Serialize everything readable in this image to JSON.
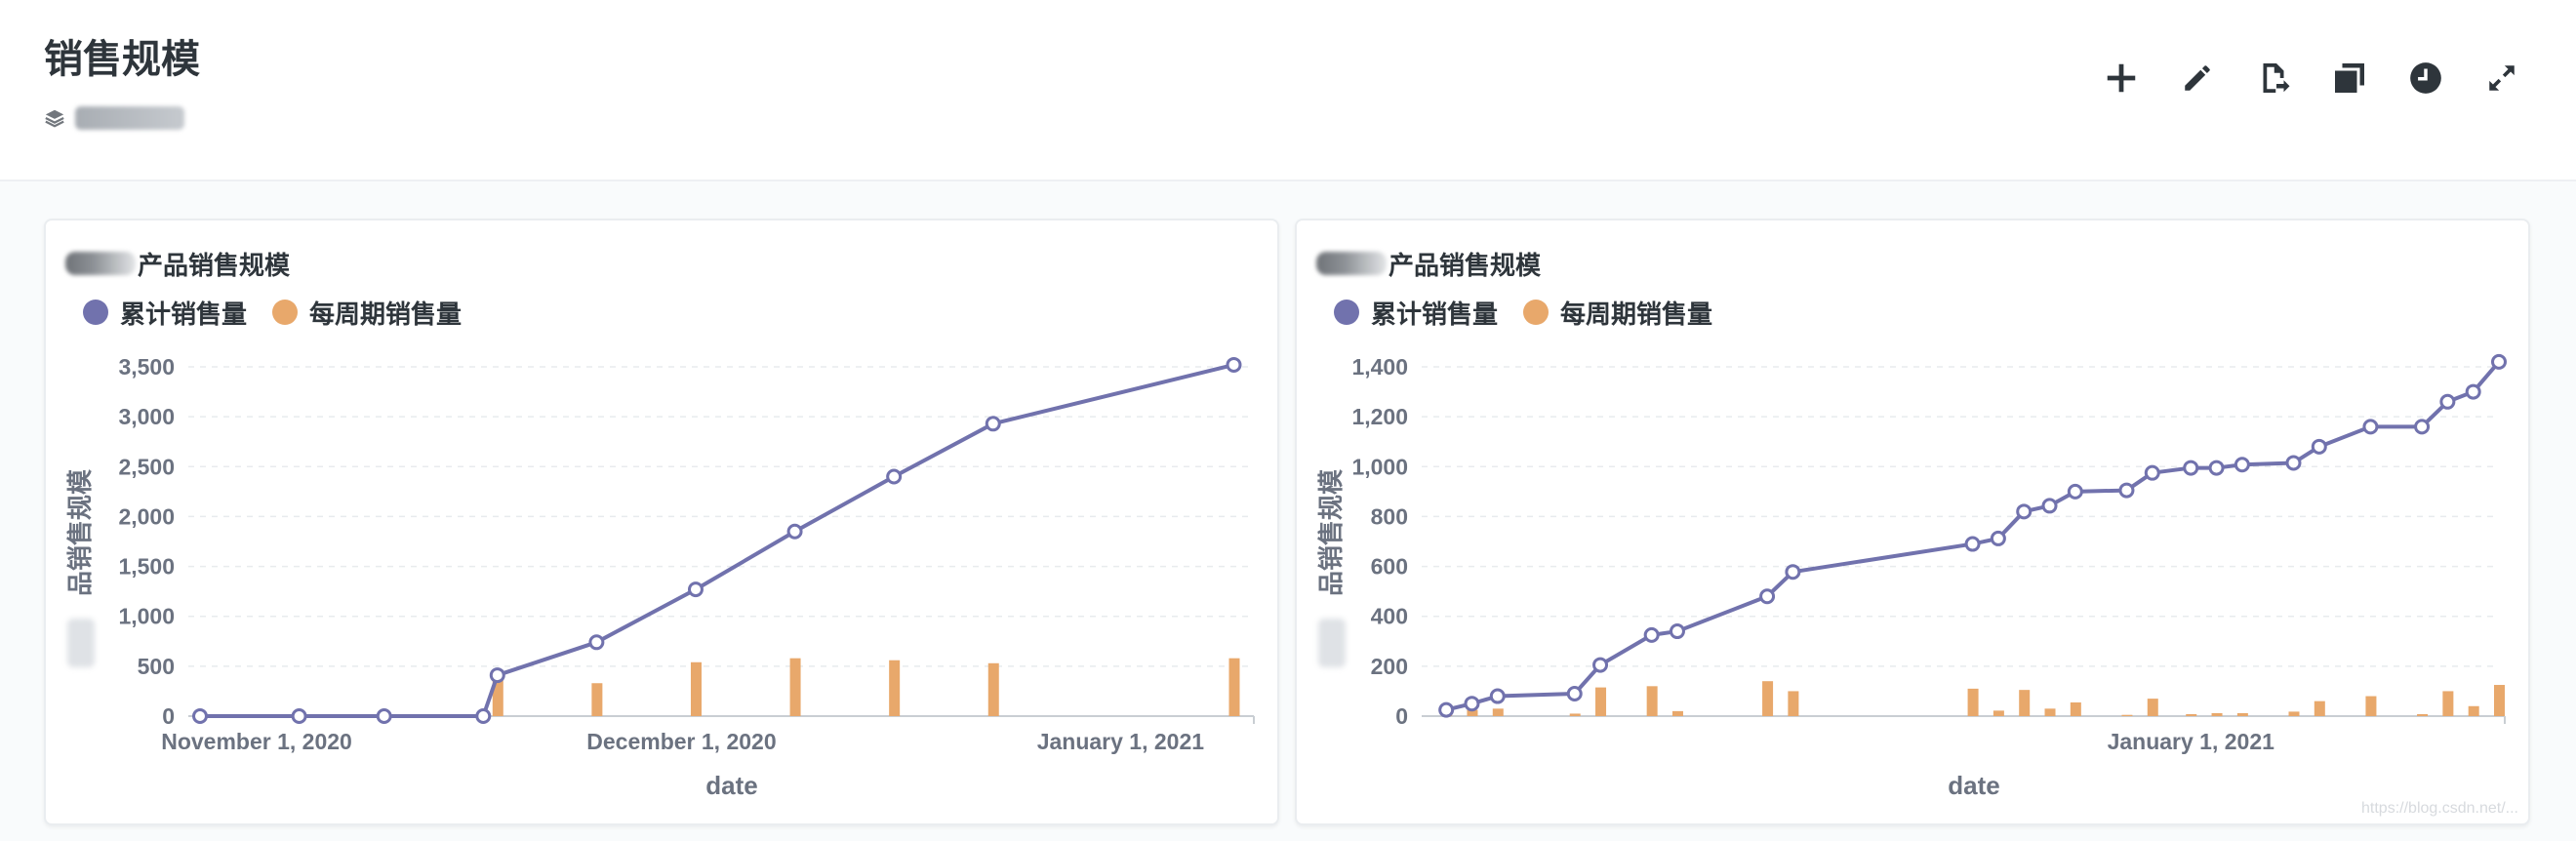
{
  "page": {
    "title": "销售规模"
  },
  "icons": {
    "collection": "layers-icon",
    "toolbar": [
      "plus-icon",
      "pencil-icon",
      "export-document-icon",
      "duplicate-icon",
      "clock-icon",
      "expand-icon"
    ]
  },
  "colors": {
    "line_series": "#7172ad",
    "bar_series": "#e8a86b",
    "axis_text": "#6b7280",
    "grid": "#e8ebee"
  },
  "chart_data": [
    {
      "type": "line+bar",
      "title": "产品销售规模",
      "legend": [
        "累计销售量",
        "每周期销售量"
      ],
      "legend_placement": "top-left",
      "xlabel": "date",
      "ylabel": "品销售规模",
      "ylim": [
        0,
        3500
      ],
      "yticks": [
        0,
        500,
        1000,
        1500,
        2000,
        2500,
        3000,
        3500
      ],
      "yticklabels": [
        "0",
        "500",
        "1,000",
        "1,500",
        "2,000",
        "2,500",
        "3,000",
        "3,500"
      ],
      "xlim": [
        "2020-10-28",
        "2021-01-10"
      ],
      "xticks": [
        "2020-11-01",
        "2020-12-01",
        "2021-01-01"
      ],
      "xticklabels": [
        "November 1, 2020",
        "December 1, 2020",
        "January 1, 2021"
      ],
      "grid": true,
      "series": [
        {
          "name": "累计销售量",
          "kind": "line",
          "x": [
            "2020-10-28",
            "2020-11-04",
            "2020-11-10",
            "2020-11-17",
            "2020-11-18",
            "2020-11-25",
            "2020-12-02",
            "2020-12-09",
            "2020-12-16",
            "2020-12-23",
            "2021-01-09"
          ],
          "values": [
            0,
            0,
            0,
            0,
            410,
            740,
            1270,
            1850,
            2400,
            2930,
            3520
          ]
        },
        {
          "name": "每周期销售量",
          "kind": "bar",
          "x": [
            "2020-11-18",
            "2020-11-25",
            "2020-12-02",
            "2020-12-09",
            "2020-12-16",
            "2020-12-23",
            "2021-01-09"
          ],
          "values": [
            410,
            330,
            540,
            580,
            560,
            530,
            580
          ]
        }
      ]
    },
    {
      "type": "line+bar",
      "title": "产品销售规模",
      "legend": [
        "累计销售量",
        "每周期销售量"
      ],
      "legend_placement": "top-left",
      "xlabel": "date",
      "ylabel": "品销售规模",
      "ylim": [
        0,
        1400
      ],
      "yticks": [
        0,
        200,
        400,
        600,
        800,
        1000,
        1200,
        1400
      ],
      "yticklabels": [
        "0",
        "200",
        "400",
        "600",
        "800",
        "1,000",
        "1,200",
        "1,400"
      ],
      "xlim": [
        "2020-11-03",
        "2021-01-25"
      ],
      "xticks": [
        "2021-01-01"
      ],
      "xticklabels": [
        "January 1, 2021"
      ],
      "grid": true,
      "series": [
        {
          "name": "累计销售量",
          "kind": "line",
          "x": [
            "2020-11-04",
            "2020-11-06",
            "2020-11-08",
            "2020-11-14",
            "2020-11-16",
            "2020-11-20",
            "2020-11-22",
            "2020-11-29",
            "2020-12-01",
            "2020-12-15",
            "2020-12-17",
            "2020-12-19",
            "2020-12-21",
            "2020-12-23",
            "2020-12-27",
            "2020-12-29",
            "2021-01-01",
            "2021-01-03",
            "2021-01-05",
            "2021-01-09",
            "2021-01-11",
            "2021-01-15",
            "2021-01-19",
            "2021-01-21",
            "2021-01-23",
            "2021-01-25"
          ],
          "values": [
            25,
            50,
            80,
            90,
            205,
            325,
            340,
            480,
            578,
            690,
            712,
            820,
            843,
            900,
            905,
            975,
            995,
            995,
            1008,
            1015,
            1080,
            1160,
            1160,
            1260,
            1300,
            1420
          ]
        },
        {
          "name": "每周期销售量",
          "kind": "bar",
          "x": [
            "2020-11-04",
            "2020-11-06",
            "2020-11-08",
            "2020-11-14",
            "2020-11-16",
            "2020-11-20",
            "2020-11-22",
            "2020-11-29",
            "2020-12-01",
            "2020-12-15",
            "2020-12-17",
            "2020-12-19",
            "2020-12-21",
            "2020-12-23",
            "2020-12-27",
            "2020-12-29",
            "2021-01-01",
            "2021-01-03",
            "2021-01-05",
            "2021-01-09",
            "2021-01-11",
            "2021-01-15",
            "2021-01-19",
            "2021-01-21",
            "2021-01-23",
            "2021-01-25"
          ],
          "values": [
            12,
            25,
            30,
            10,
            115,
            120,
            20,
            140,
            100,
            110,
            22,
            105,
            30,
            55,
            5,
            70,
            8,
            12,
            12,
            18,
            60,
            80,
            8,
            100,
            40,
            125
          ]
        }
      ]
    }
  ],
  "watermark": "https://blog.csdn.net/..."
}
